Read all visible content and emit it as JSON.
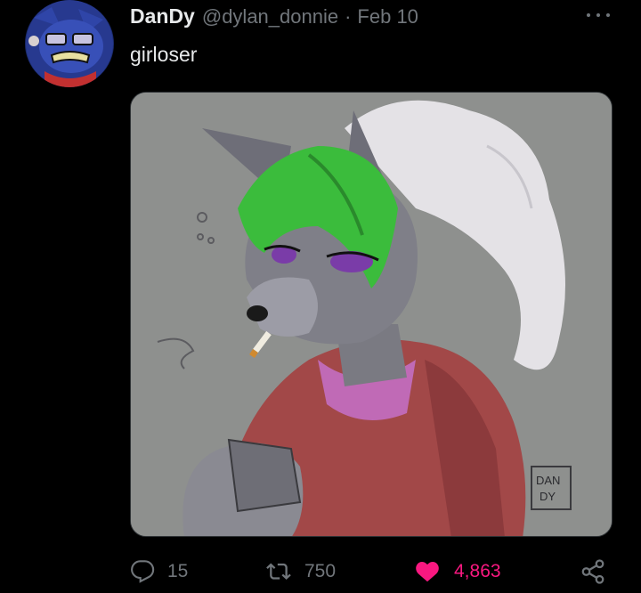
{
  "tweet": {
    "display_name": "DanDy",
    "handle": "@dylan_donnie",
    "separator": "·",
    "date": "Feb 10",
    "text": "girloser"
  },
  "media": {
    "alt": "Sketch of a grey wolf character with green hair and a red hoodie",
    "signature": "DAN DY"
  },
  "actions": {
    "replies": "15",
    "retweets": "750",
    "likes": "4,863",
    "liked": true
  },
  "icons": {
    "avatar": "avatar",
    "more": "more-icon",
    "reply": "reply-icon",
    "retweet": "retweet-icon",
    "like": "heart-icon",
    "share": "share-icon"
  },
  "colors": {
    "background": "#000000",
    "primary_text": "#e7e9ea",
    "secondary_text": "#71767b",
    "like": "#f91880"
  }
}
